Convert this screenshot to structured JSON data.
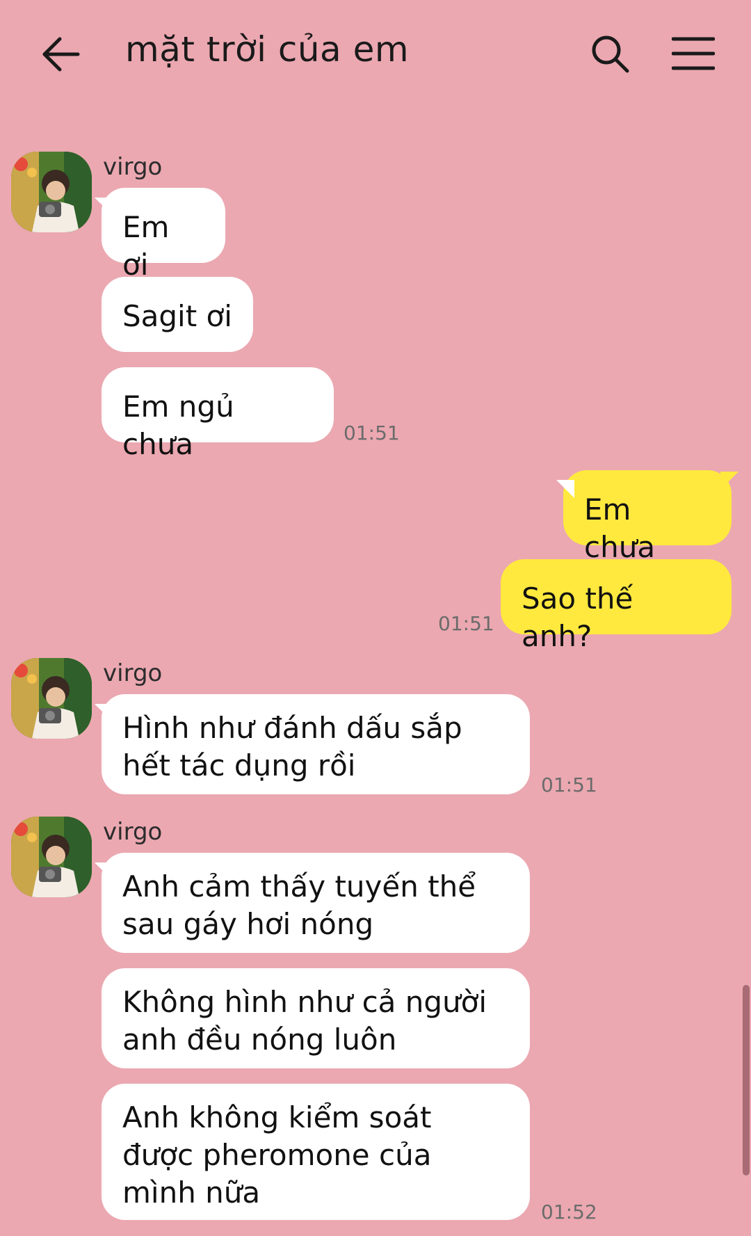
{
  "header": {
    "title": "mặt trời của em"
  },
  "messages": [
    {
      "sender": "virgo",
      "bubbles": [
        "Em ơi",
        "Sagit ơi",
        "Em ngủ chưa"
      ],
      "time": "01:51"
    },
    {
      "sender": "me",
      "bubbles": [
        "Em chưa",
        "Sao thế anh?"
      ],
      "time": "01:51"
    },
    {
      "sender": "virgo",
      "bubbles": [
        "Hình như đánh dấu sắp hết tác dụng rồi"
      ],
      "time": "01:51"
    },
    {
      "sender": "virgo",
      "bubbles": [
        "Anh cảm thấy tuyến thể sau gáy hơi nóng",
        "Không hình như cả người anh đều nóng luôn",
        "Anh không kiểm soát được pheromone của mình nữa"
      ],
      "time": "01:52"
    }
  ],
  "colors": {
    "background": "#eba8b1",
    "my_bubble": "#ffe93e",
    "their_bubble": "#ffffff"
  }
}
